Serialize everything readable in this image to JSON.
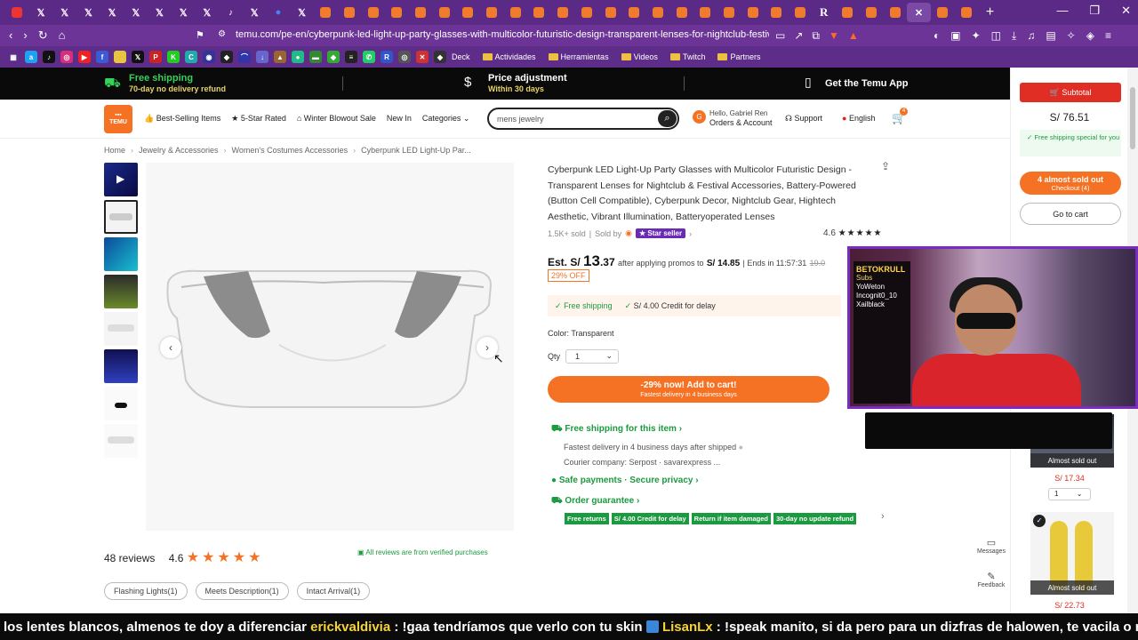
{
  "browser": {
    "url": "temu.com/pe-en/cyberpunk-led-light-up-party-glasses-with-multicolor-futuristic-design-transparent-lenses-for-nightclub-festival-accessories-",
    "bookmarks": [
      "Deck",
      "Actividades",
      "Herramientas",
      "Videos",
      "Twitch",
      "Partners"
    ]
  },
  "promo": {
    "free_shipping": "Free shipping",
    "free_shipping_sub": "70-day no delivery refund",
    "price_adj": "Price adjustment",
    "price_adj_sub": "Within 30 days",
    "app": "Get the Temu App"
  },
  "header": {
    "logo": "TEMU",
    "nav": [
      "Best-Selling Items",
      "5-Star Rated",
      "Winter Blowout Sale",
      "New In",
      "Categories"
    ],
    "search_placeholder": "mens jewelry",
    "account_greeting": "Hello, Gabriel Ren",
    "account_label": "Orders & Account",
    "avatar_letter": "G",
    "support": "Support",
    "language": "English",
    "cart_count": "4"
  },
  "breadcrumb": [
    "Home",
    "Jewelry & Accessories",
    "Women's Costumes Accessories",
    "Cyberpunk LED Light-Up Par..."
  ],
  "product": {
    "title": "Cyberpunk LED Light-Up Party Glasses with Multicolor Futuristic Design - Transparent Lenses for Nightclub & Festival Accessories, Battery-Powered (Button Cell Compatible), Cyberpunk Decor, Nightclub Gear, Hightech Aesthetic, Vibrant Illumination, Batteryoperated Lenses",
    "sold": "1.5K+ sold",
    "sold_by": "Sold by",
    "star_seller": "Star seller",
    "rating": "4.6",
    "price_prefix": "Est. S/",
    "price_main": "13",
    "price_cents": ".37",
    "after_promo": "after applying promos to",
    "promo_price": "S/ 14.85",
    "ends_label": "Ends in",
    "ends_time": "11:57:31",
    "old_price": "19.0",
    "discount": "29% OFF",
    "ship_free": "Free shipping",
    "ship_credit": "S/ 4.00 Credit for delay",
    "color": "Color: Transparent",
    "qty_label": "Qty",
    "qty_value": "1",
    "add_to_cart": "-29% now! Add to cart!",
    "add_to_cart_sub": "Fastest delivery in 4 business days"
  },
  "guarantees": {
    "free_ship_item": "Free shipping for this item",
    "fastest": "Fastest delivery in 4 business days after shipped",
    "courier": "Courier company:",
    "couriers": "Serpost · savarexpress ...",
    "safe_payments": "Safe payments · Secure privacy",
    "order_guarantee": "Order guarantee",
    "badges": [
      "Free returns",
      "S/ 4.00 Credit for delay",
      "Return if item damaged",
      "30-day no update refund"
    ]
  },
  "reviews": {
    "count": "48 reviews",
    "rating": "4.6",
    "verified": "All reviews are from verified purchases",
    "chips": [
      "Flashing Lights(1)",
      "Meets Description(1)",
      "Intact Arrival(1)"
    ]
  },
  "sidebar": {
    "subtotal": "Subtotal",
    "price": "S/ 76.51",
    "free_special": "Free shipping special for you",
    "almost": "4 almost sold out",
    "checkout": "Checkout (4)",
    "go_to_cart": "Go to cart",
    "item1_tag": "Almost sold out",
    "item1_price": "S/ 17.34",
    "item1_qty": "1",
    "item2_tag": "Almost sold out",
    "item2_price": "S/ 22.73",
    "messages": "Messages",
    "feedback": "Feedback"
  },
  "stream": {
    "overlay_title": "BETOKRULL",
    "overlay_subs": "Subs",
    "overlay_names": [
      "YoWeton",
      "Incognit0_10",
      "Xailblack"
    ],
    "ticker_pre": "los lentes blancos, almenos te doy a diferenciar ",
    "ticker_u1": "erickvaldivia",
    "ticker_m1": " : !gaa tendríamos que verlo con tu skin ",
    "ticker_u2": "LisanLx",
    "ticker_m2": " : !speak manito, si da pero para un dizfras de halowen, te vacila o nada ?"
  },
  "colors": {
    "accent": "#f57224",
    "green": "#1b9a3f",
    "browser": "#5b2a86"
  }
}
